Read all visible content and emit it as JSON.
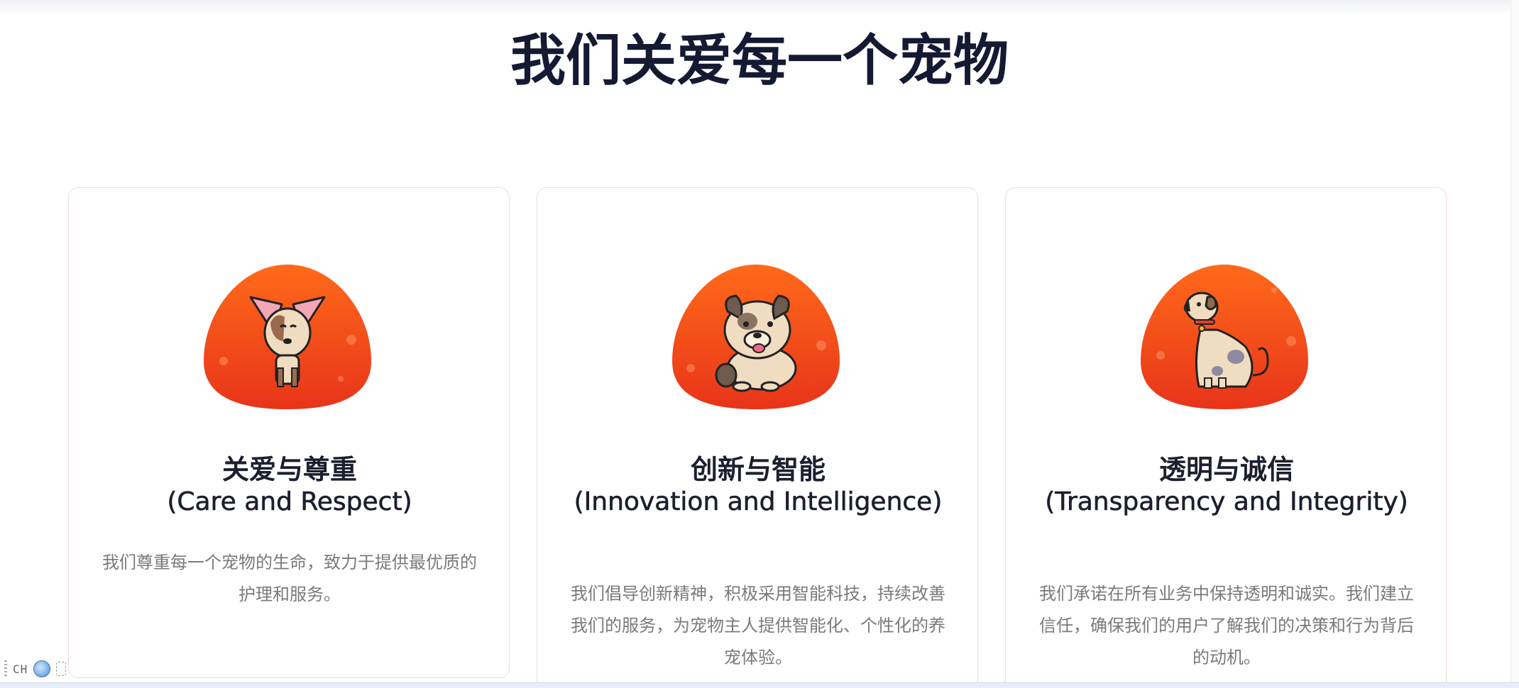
{
  "header": {
    "title": "我们关爱每一个宠物"
  },
  "cards": [
    {
      "title_zh": "关爱与尊重",
      "title_en": "(Care and Respect)",
      "description": "我们尊重每一个宠物的生命，致力于提供最优质的护理和服务。",
      "icon": "chihuahua-dog-icon"
    },
    {
      "title_zh": "创新与智能",
      "title_en": "(Innovation and Intelligence)",
      "description": "我们倡导创新精神，积极采用智能科技，持续改善我们的服务，为宠物主人提供智能化、个性化的养宠体验。",
      "icon": "bulldog-icon"
    },
    {
      "title_zh": "透明与诚信",
      "title_en": "(Transparency and Integrity)",
      "description": "我们承诺在所有业务中保持透明和诚实。我们建立信任，确保我们的用户了解我们的决策和行为背后的动机。",
      "icon": "sitting-spotted-dog-icon"
    }
  ],
  "ime": {
    "label": "CH",
    "icons": [
      "drag-handle-icon",
      "globe-icon",
      "soft-keyboard-icon"
    ]
  },
  "colors": {
    "title": "#151a33",
    "blob_top": "#ff6a1a",
    "blob_bottom": "#e8341a",
    "card_border": "#f0d9de",
    "description": "#7a7a7a"
  }
}
